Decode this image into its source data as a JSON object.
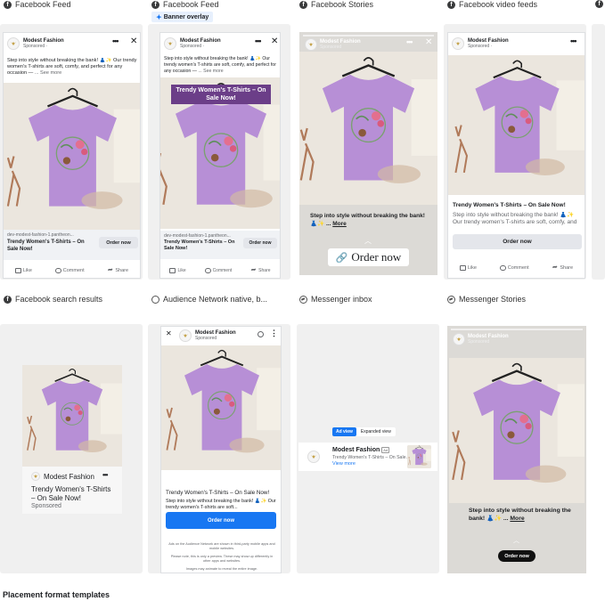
{
  "placements": {
    "fb_feed": "Facebook Feed",
    "fb_feed_overlay": "Facebook Feed",
    "fb_stories": "Facebook Stories",
    "fb_video": "Facebook video feeds",
    "fb_search": "Facebook search results",
    "audience_network": "Audience Network native, b...",
    "messenger_inbox": "Messenger inbox",
    "messenger_stories": "Messenger Stories"
  },
  "banner_overlay_label": "Banner overlay",
  "ad": {
    "brand": "Modest Fashion",
    "sponsored": "Sponsored ·",
    "sponsored_plain": "Sponsored",
    "body": "Step into style without breaking the bank! 👗✨ Our trendy women's T-shirts are soft, comfy, and perfect for any occasion —",
    "body_short": "Step into style without breaking the bank! 👗✨ Our trendy women's T-shirts are soft, comfy, and perfect for any occasion —",
    "see_more": "... See more",
    "url": "dev-modest-fashion-1.pantheon...",
    "headline": "Trendy Women's T-Shirts – On Sale Now!",
    "headline_break": "Trendy Women's T-Shirts – On Sale Now!",
    "cta": "Order now",
    "overlay_text": "Trendy Women's T-Shirts – On Sale Now!",
    "story_text": "Step into style without breaking the bank! 👗✨ ...",
    "more": "More",
    "story_cta": "Order now"
  },
  "actions": {
    "like": "Like",
    "comment": "Comment",
    "share": "Share"
  },
  "audience": {
    "headline": "Trendy Women's T-Shirts – On Sale Now!",
    "body": "Step into style without breaking the bank! 👗✨ Our trendy women's T-shirts are soft...",
    "cta": "Order now",
    "foot1": "Ads on the Audience Network are shown in third-party mobile apps and mobile websites.",
    "foot2": "Please note, this is only a preview. These may show up differently in other apps and websites.",
    "foot3": "Images may animate to reveal the entire image."
  },
  "messenger": {
    "tab_ad": "Ad view",
    "tab_expanded": "Expanded view",
    "brand": "Modest Fashion",
    "ad_badge": "Ad",
    "snippet": "Trendy Women's T-Shirts – On Sale...",
    "view_more": "View more"
  },
  "search": {
    "brand": "Modest Fashion",
    "headline": "Trendy Women's T-Shirts – On Sale Now!",
    "sponsored": "Sponsored"
  },
  "footer_title": "Placement format templates",
  "colors": {
    "shirt": "#b78fd6",
    "cta_blue": "#1877f2",
    "overlay": "#6b3e88"
  }
}
